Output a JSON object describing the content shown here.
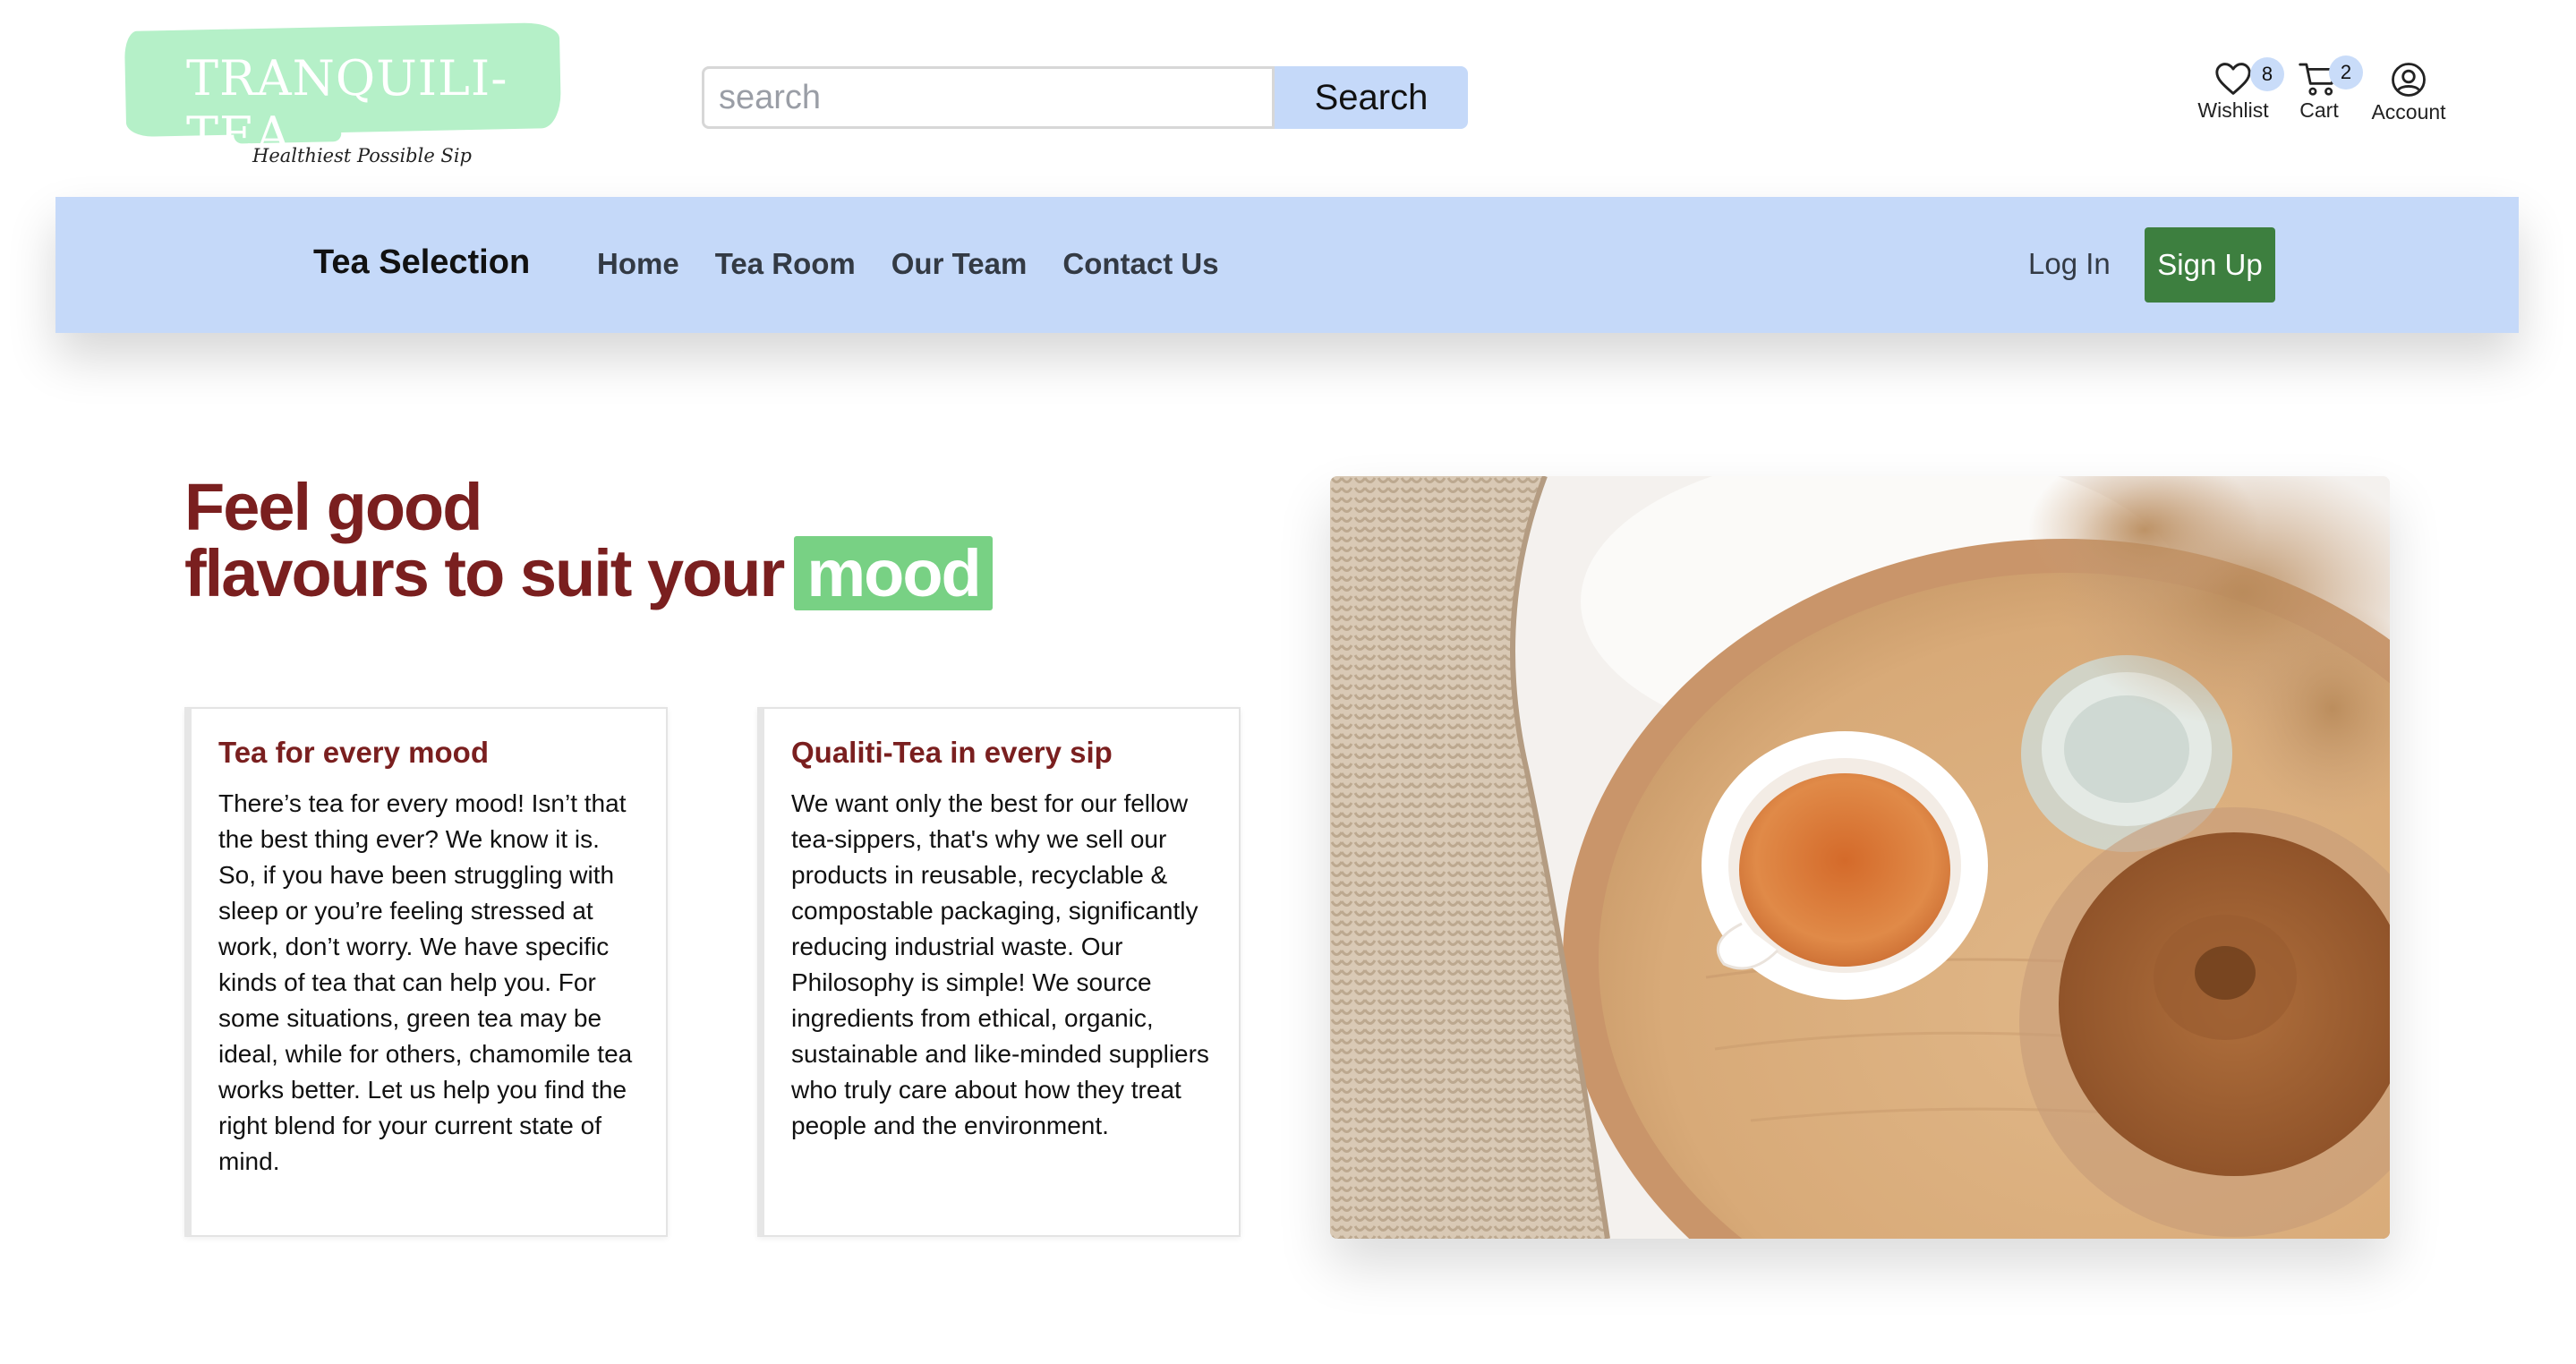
{
  "header": {
    "logo_text": "TRANQUILI-TEA",
    "tagline": "Healthiest Possible Sip",
    "search": {
      "placeholder": "search",
      "value": "",
      "button_label": "Search"
    },
    "icons": [
      {
        "name": "heart-icon",
        "label": "Wishlist",
        "badge": "8"
      },
      {
        "name": "cart-icon",
        "label": "Cart",
        "badge": "2"
      },
      {
        "name": "account-icon",
        "label": "Account"
      }
    ]
  },
  "navbar": {
    "brand": "Tea Selection",
    "links": [
      "Home",
      "Tea Room",
      "Our Team",
      "Contact Us"
    ],
    "login": "Log In",
    "signup": "Sign Up"
  },
  "hero": {
    "headline_line1": "Feel good",
    "headline_line2": "flavours to suit your",
    "headline_highlight": "mood",
    "cards": [
      {
        "title": "Tea for every mood",
        "body": "There’s tea for every mood! Isn’t that the best thing ever? We know it is. So, if you have been struggling with sleep or you’re feeling stressed at work, don’t worry. We have specific kinds of tea that can help you. For some situations, green tea may be ideal, while for others, chamomile tea works better. Let us help you find the right blend for your current state of mind."
      },
      {
        "title": "Qualiti-Tea in every sip",
        "body": "We want only the best for our fellow tea-sippers, that's why we sell our products in reusable, recyclable & compostable packaging, significantly reducing industrial waste. Our Philosophy is simple! We source ingredients from ethical, organic, sustainable and like-minded suppliers who truly care about how they treat people and the environment."
      }
    ]
  },
  "colors": {
    "logo_green": "#b5f0c8",
    "navbar_blue": "#c5d9f9",
    "signup_green": "#3d7f3f",
    "headline_maroon": "#7a1f1f",
    "highlight_green": "#78d184"
  }
}
